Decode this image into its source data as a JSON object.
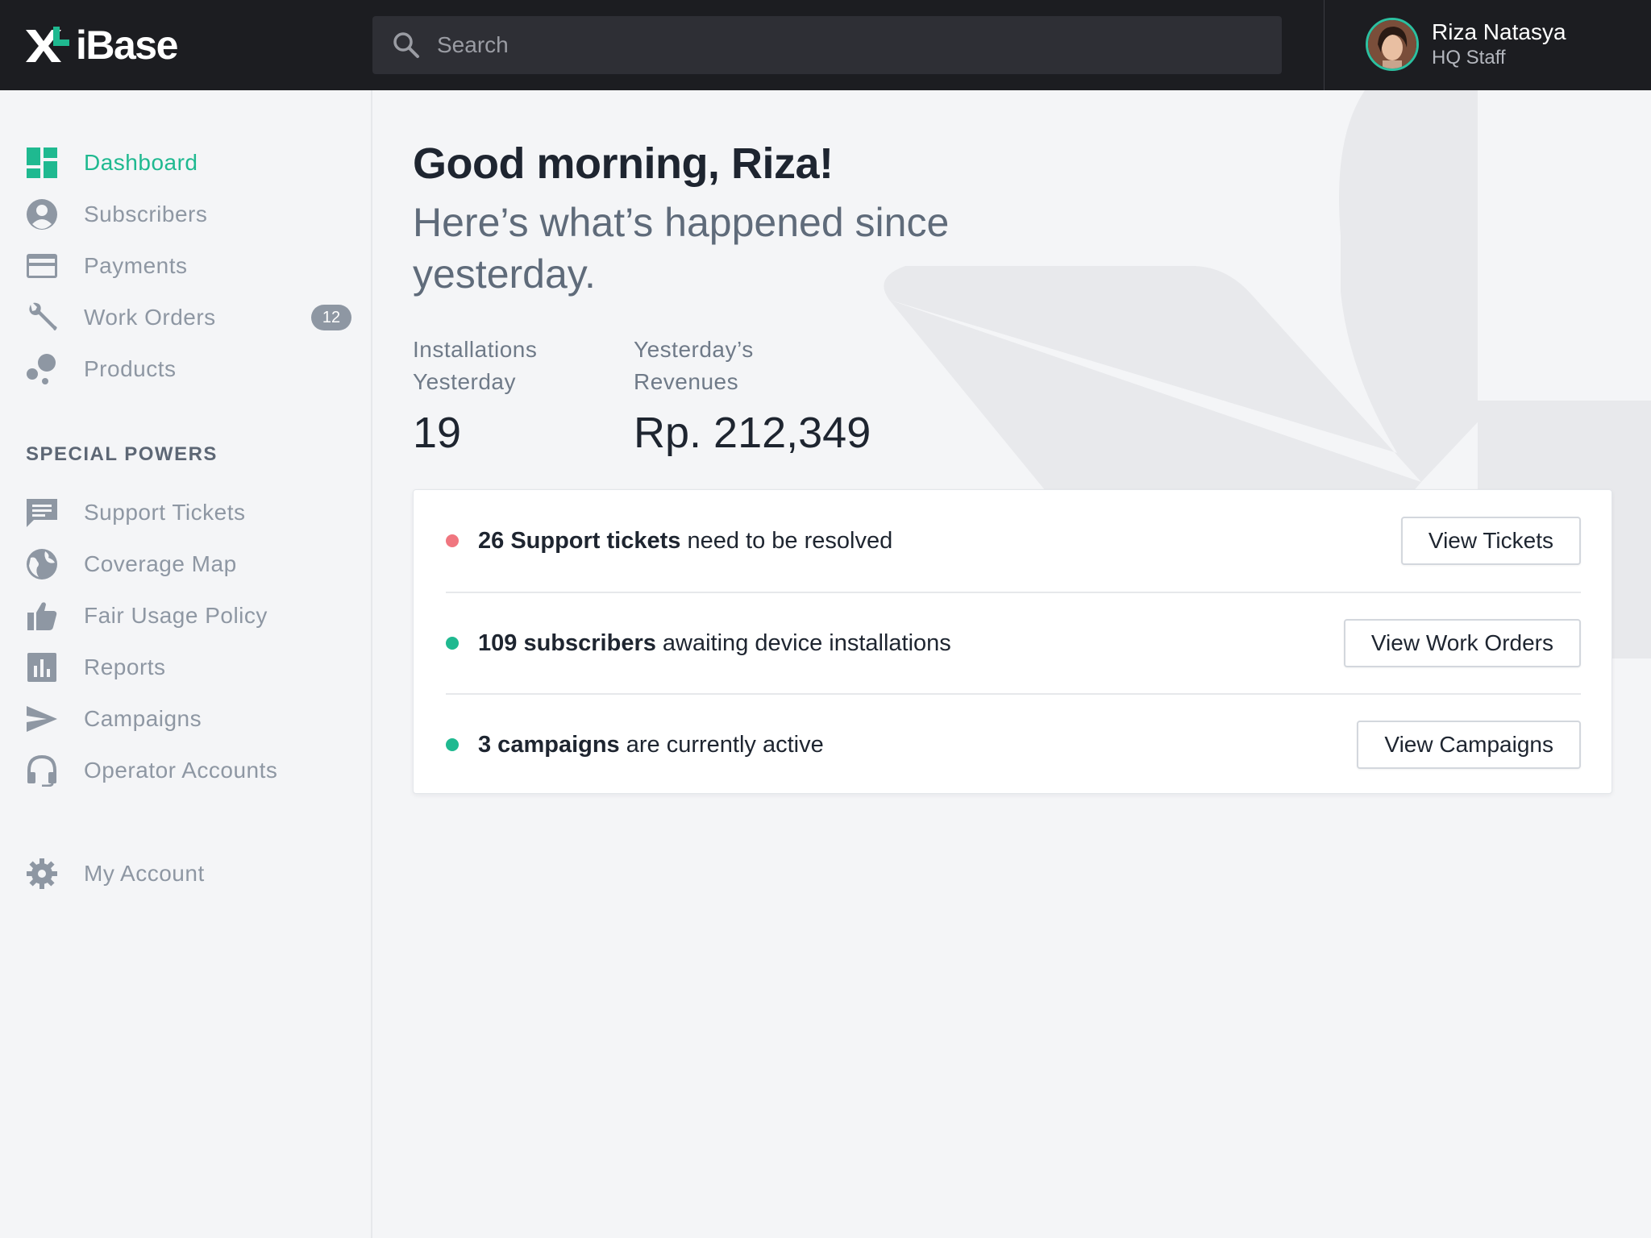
{
  "app": {
    "name": "iBase",
    "brand_color": "#1fb990"
  },
  "search": {
    "placeholder": "Search"
  },
  "user": {
    "name": "Riza Natasya",
    "role": "HQ Staff"
  },
  "sidebar": {
    "items": [
      {
        "label": "Dashboard",
        "icon": "dashboard-icon",
        "active": true
      },
      {
        "label": "Subscribers",
        "icon": "user-circle-icon"
      },
      {
        "label": "Payments",
        "icon": "credit-card-icon"
      },
      {
        "label": "Work Orders",
        "icon": "wrench-icon",
        "badge": "12"
      },
      {
        "label": "Products",
        "icon": "bubbles-icon"
      }
    ],
    "section_title": "SPECIAL POWERS",
    "special_items": [
      {
        "label": "Support Tickets",
        "icon": "chat-icon"
      },
      {
        "label": "Coverage Map",
        "icon": "globe-icon"
      },
      {
        "label": "Fair Usage Policy",
        "icon": "thumbs-up-icon"
      },
      {
        "label": "Reports",
        "icon": "bar-chart-icon"
      },
      {
        "label": "Campaigns",
        "icon": "send-icon"
      },
      {
        "label": "Operator Accounts",
        "icon": "headset-icon"
      }
    ],
    "account": {
      "label": "My Account",
      "icon": "gear-icon"
    }
  },
  "main": {
    "greeting": "Good morning, Riza!",
    "subline": "Here’s what’s happened since yesterday.",
    "stats": [
      {
        "label": "Installations\nYesterday",
        "value": "19"
      },
      {
        "label": "Yesterday’s\nRevenues",
        "value": "Rp. 212,349"
      }
    ],
    "alerts": [
      {
        "strong": "26 Support tickets",
        "rest": " need to be resolved",
        "status_color": "#f0767f",
        "button": "View Tickets"
      },
      {
        "strong": "109 subscribers",
        "rest": " awaiting device installations",
        "status_color": "#1fb990",
        "button": "View Work Orders"
      },
      {
        "strong": "3 campaigns",
        "rest": " are currently active",
        "status_color": "#1fb990",
        "button": "View Campaigns"
      }
    ]
  }
}
